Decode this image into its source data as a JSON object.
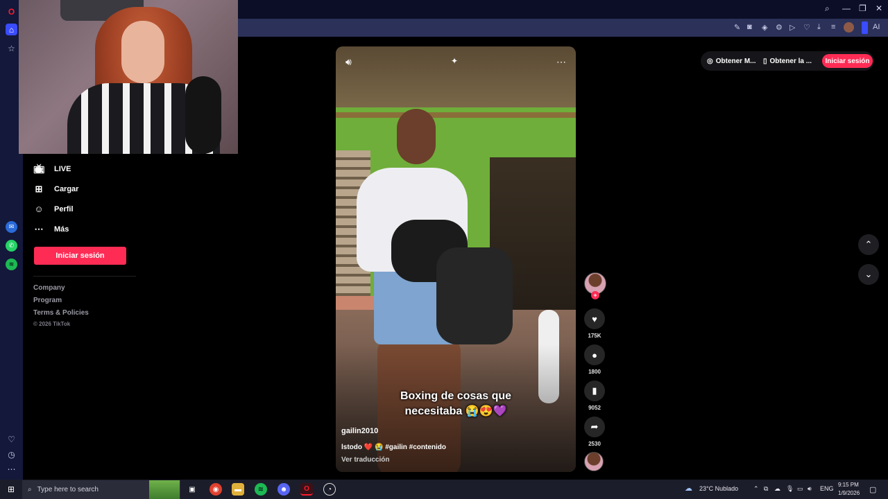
{
  "browser": {
    "toolbar_icons": [
      "edit-icon",
      "camera-icon",
      "shield-icon",
      "extension-icon",
      "play-icon",
      "heart-icon",
      "download-icon",
      "menu-icon",
      "profile-icon",
      "ai-icon"
    ],
    "ai_label": "AI"
  },
  "tiktok_nav": {
    "items": [
      {
        "icon": "live-icon",
        "label": "LIVE"
      },
      {
        "icon": "upload-icon",
        "label": "Cargar"
      },
      {
        "icon": "profile-icon",
        "label": "Perfil"
      },
      {
        "icon": "more-icon",
        "label": "Más"
      }
    ],
    "login_label": "Iniciar sesión",
    "footer": [
      "Company",
      "Program",
      "Terms & Policies"
    ],
    "copyright": "© 2026 TikTok"
  },
  "header": {
    "get_coins_label": "Obtener M...",
    "get_app_label": "Obtener la ...",
    "login_label": "Iniciar sesión"
  },
  "video": {
    "caption_line1": "Boxing de cosas que",
    "caption_line2": "necesitaba 😭😍💜",
    "username": "gailin2010",
    "description": "lstodo ❤️ 😭 #gailin #contenido",
    "translate_label": "Ver traducción"
  },
  "actions": {
    "likes": "175K",
    "comments": "1800",
    "saves": "9052",
    "shares": "2530"
  },
  "taskbar": {
    "search_placeholder": "Type here to search",
    "weather": "23°C  Nublado",
    "lang": "ENG",
    "time": "9:15 PM",
    "date": "1/9/2026"
  },
  "colors": {
    "accent": "#fe2c55",
    "rail": "#14183a",
    "addressbar": "#2b3159"
  }
}
